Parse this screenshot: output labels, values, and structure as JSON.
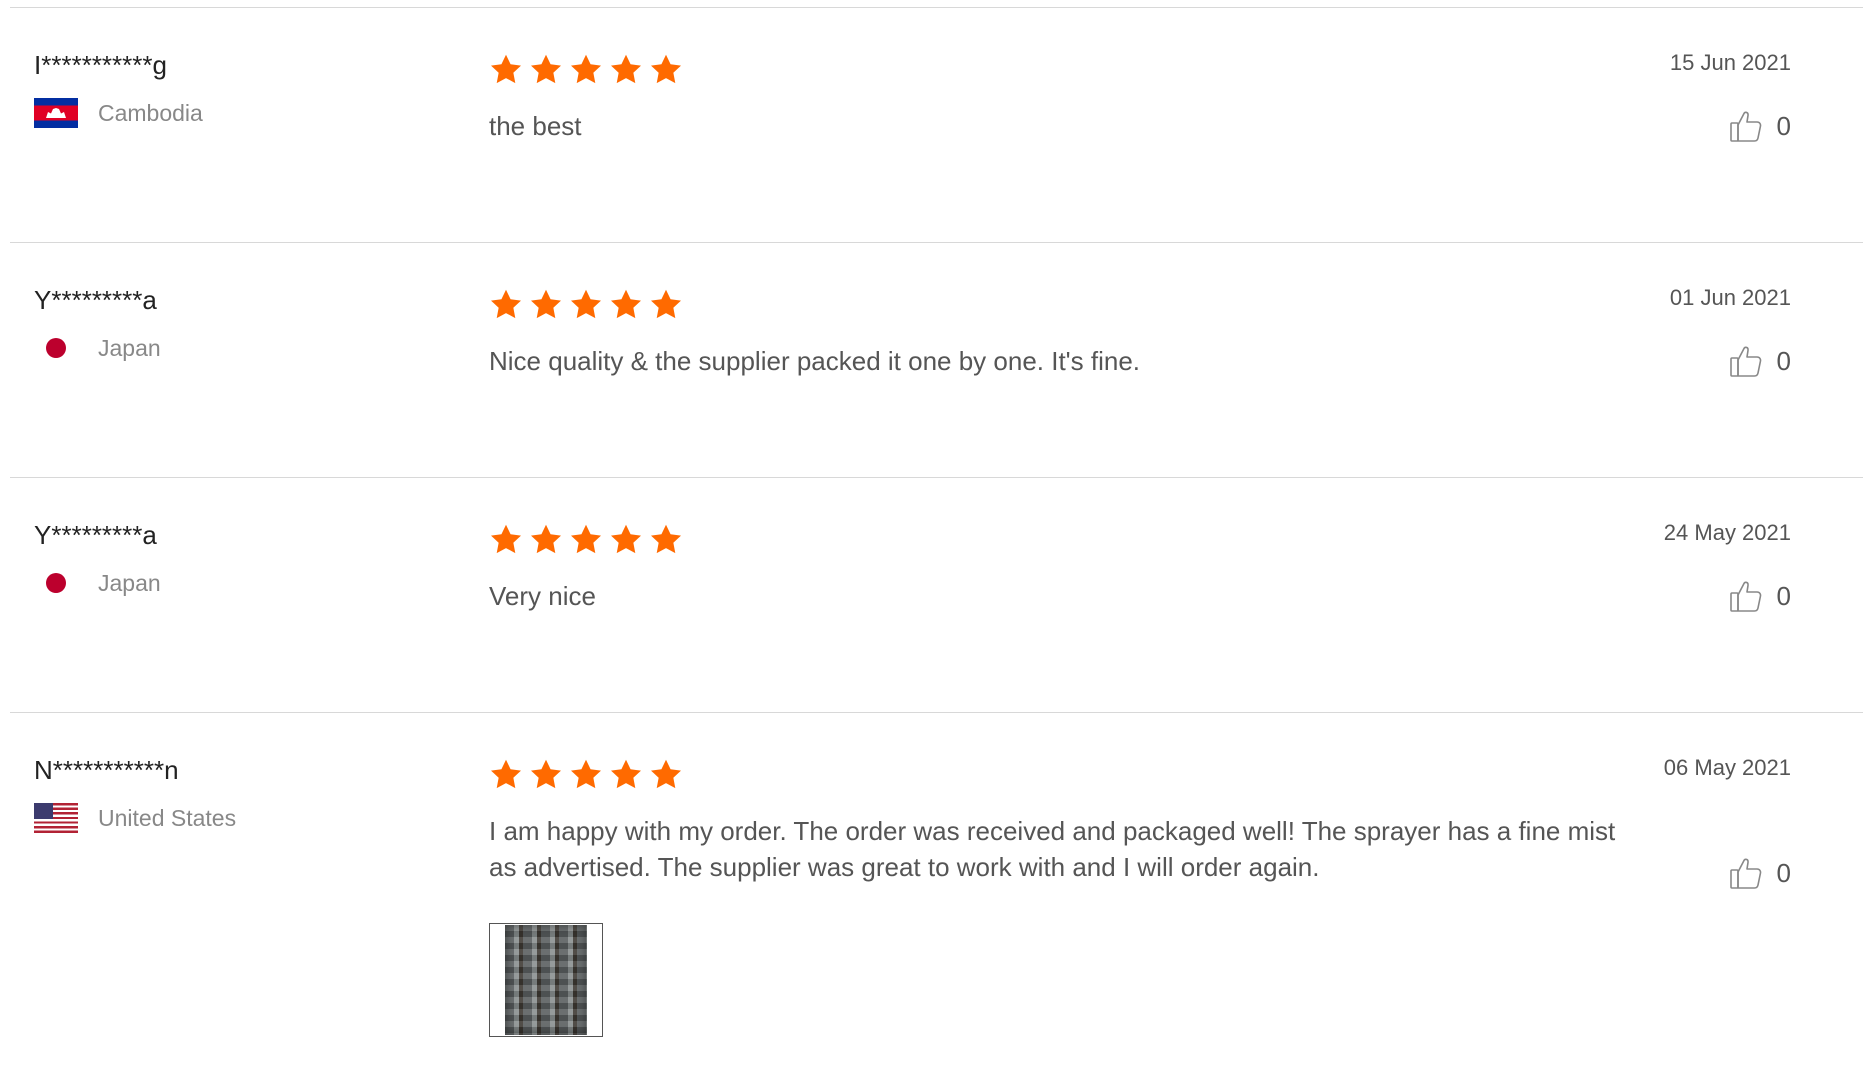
{
  "reviews": [
    {
      "reviewer": "I***********g",
      "country": "Cambodia",
      "flag_icon": "cambodia-flag-icon",
      "rating": 5,
      "comment": "the best",
      "date": "15 Jun 2021",
      "likes": "0"
    },
    {
      "reviewer": "Y*********a",
      "country": "Japan",
      "flag_icon": "japan-flag-icon",
      "rating": 5,
      "comment": "Nice quality & the supplier packed it one by one. It's fine.",
      "date": "01 Jun 2021",
      "likes": "0"
    },
    {
      "reviewer": "Y*********a",
      "country": "Japan",
      "flag_icon": "japan-flag-icon",
      "rating": 5,
      "comment": "Very nice",
      "date": "24 May 2021",
      "likes": "0"
    },
    {
      "reviewer": "N***********n",
      "country": "United States",
      "flag_icon": "united-states-flag-icon",
      "rating": 5,
      "comment": "I am happy with my order. The order was received and packaged well! The sprayer has a fine mist as advertised. The supplier was great to work with and I will order again.",
      "date": "06 May 2021",
      "likes": "0",
      "photos": 1
    }
  ],
  "colors": {
    "star": "#ff6a00",
    "divider": "#d8d8d8",
    "text": "#555555",
    "muted": "#888888"
  },
  "icons": {
    "star": "star-icon",
    "like": "thumbs-up-icon"
  }
}
